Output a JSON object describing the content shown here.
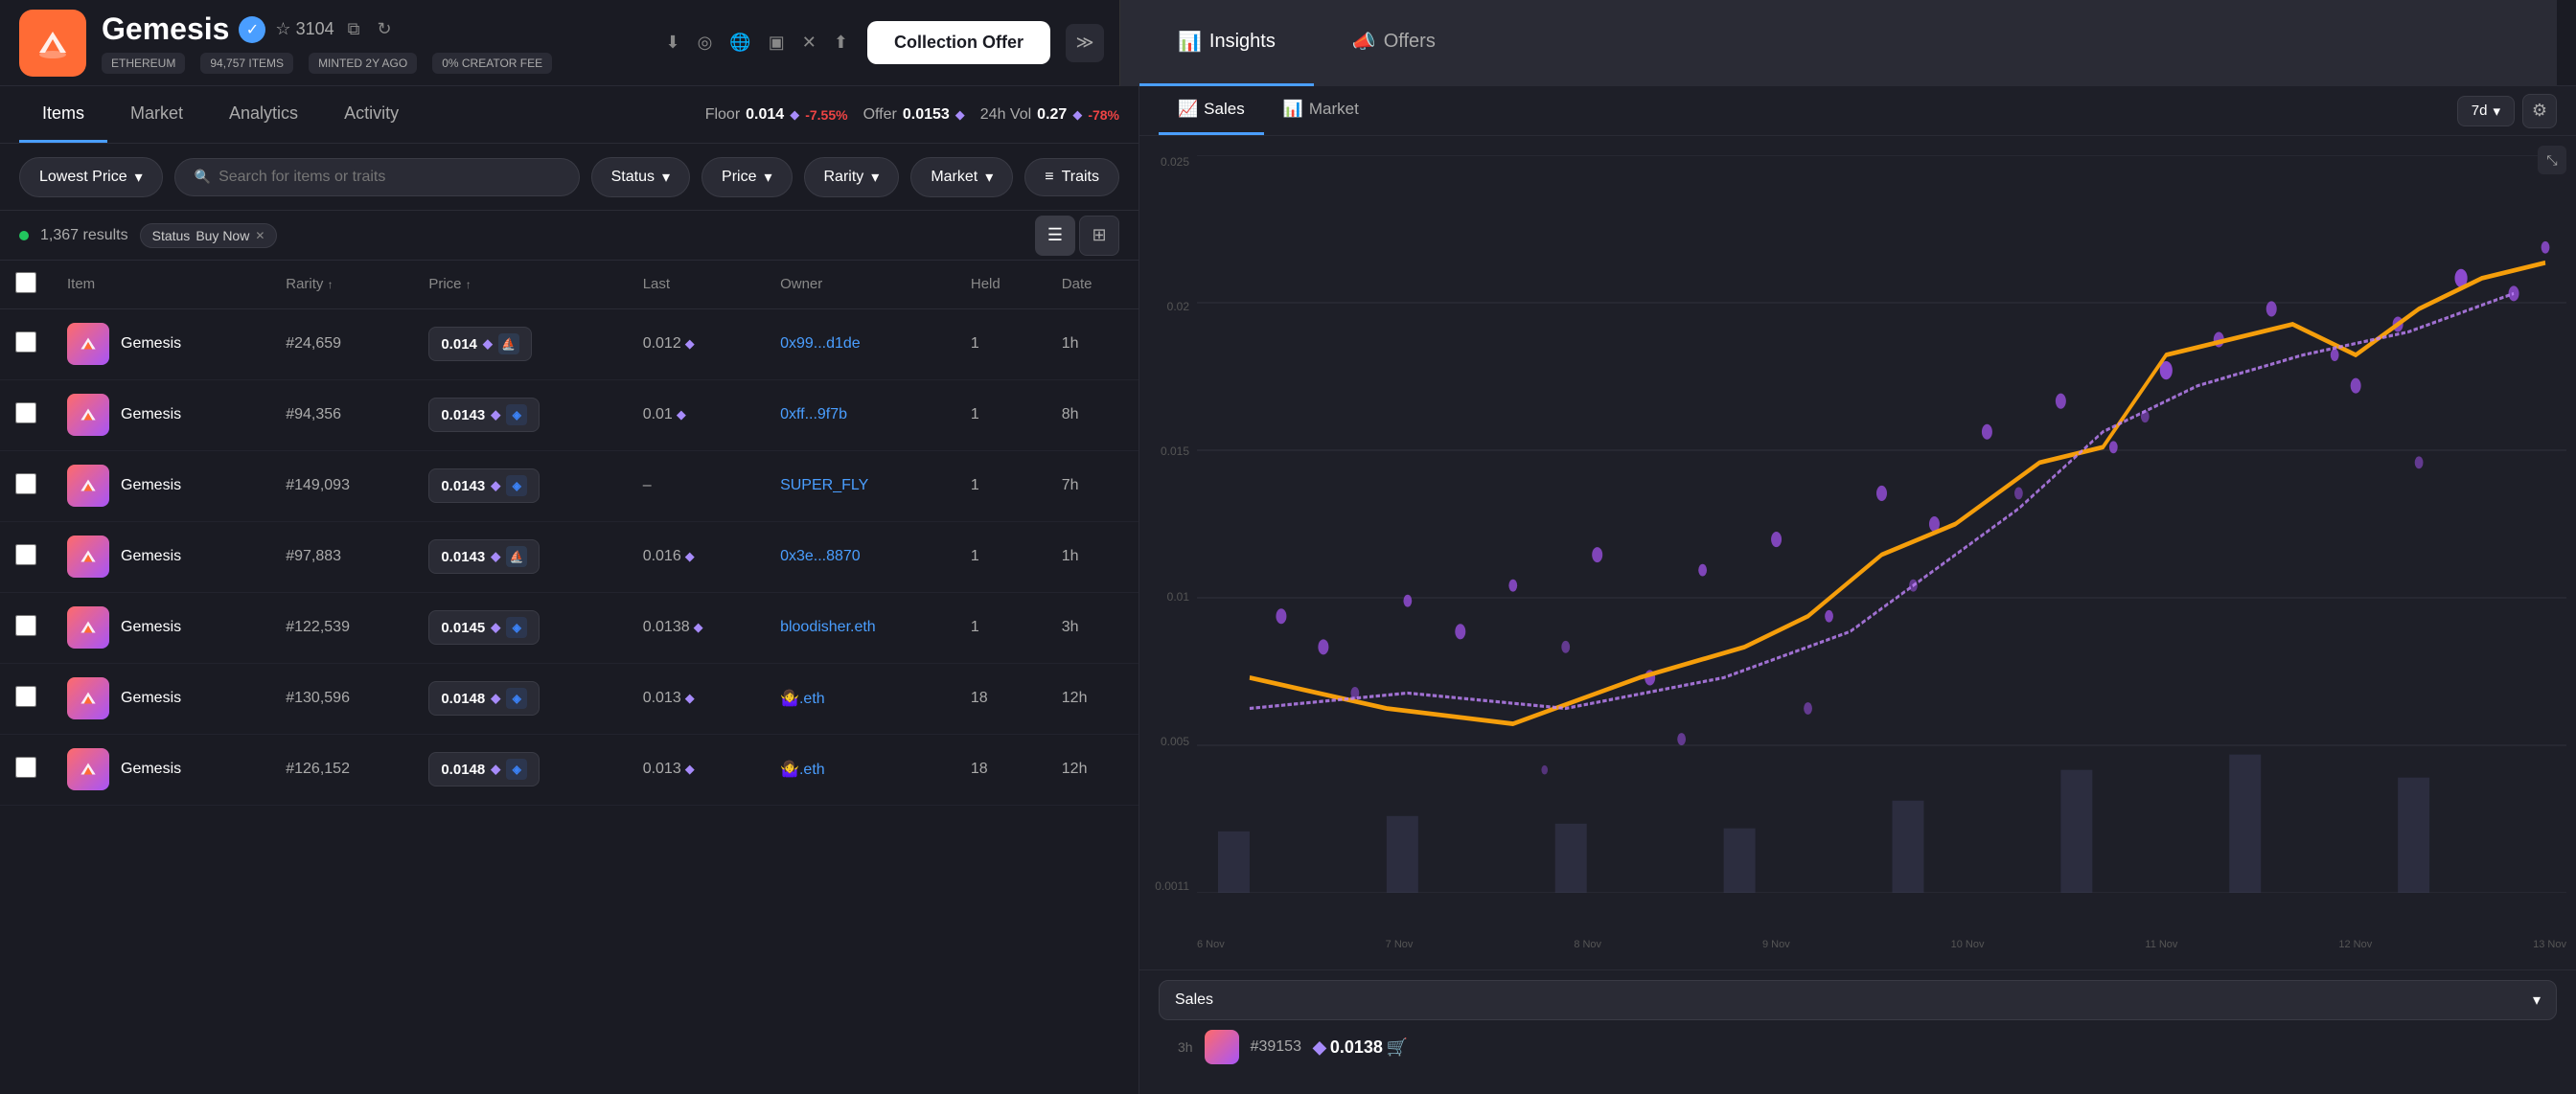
{
  "header": {
    "logo_emoji": "⛵",
    "collection_name": "Gemesis",
    "verified": true,
    "star_count": "3104",
    "chain": "ETHEREUM",
    "items_count": "94,757 ITEMS",
    "minted": "MINTED 2Y AGO",
    "creator_fee": "0% CREATOR FEE",
    "collection_offer_label": "Collection Offer"
  },
  "insights_panel": {
    "insights_label": "Insights",
    "offers_label": "Offers"
  },
  "nav": {
    "tabs": [
      "Items",
      "Market",
      "Analytics",
      "Activity"
    ],
    "active": "Items"
  },
  "price_bar": {
    "floor_label": "Floor",
    "floor_value": "0.014",
    "floor_change": "-7.55%",
    "offer_label": "Offer",
    "offer_value": "0.0153",
    "vol_label": "24h Vol",
    "vol_value": "0.27",
    "vol_change": "-78%"
  },
  "filters": {
    "sort_label": "Lowest Price",
    "search_placeholder": "Search for items or traits",
    "status_label": "Status",
    "price_label": "Price",
    "rarity_label": "Rarity",
    "market_label": "Market",
    "traits_label": "Traits"
  },
  "results": {
    "count": "1,367 results",
    "status_badge_label": "Status",
    "status_badge_value": "Buy Now"
  },
  "table": {
    "columns": [
      "Item",
      "Rarity ↑",
      "Price ↑",
      "Last",
      "Owner",
      "Held",
      "Date"
    ],
    "rows": [
      {
        "id": 1,
        "name": "Gemesis",
        "rarity": "#24,659",
        "price": "0.014",
        "price_market": "os",
        "last": "0.012",
        "owner": "0x99...d1de",
        "owner_type": "address",
        "held": "1",
        "date": "1h"
      },
      {
        "id": 2,
        "name": "Gemesis",
        "rarity": "#94,356",
        "price": "0.0143",
        "price_market": "blue",
        "last": "0.01",
        "owner": "0xff...9f7b",
        "owner_type": "address",
        "held": "1",
        "date": "8h"
      },
      {
        "id": 3,
        "name": "Gemesis",
        "rarity": "#149,093",
        "price": "0.0143",
        "price_market": "blue",
        "last": "–",
        "owner": "SUPER_FLY",
        "owner_type": "named",
        "held": "1",
        "date": "7h"
      },
      {
        "id": 4,
        "name": "Gemesis",
        "rarity": "#97,883",
        "price": "0.0143",
        "price_market": "os",
        "last": "0.016",
        "owner": "0x3e...8870",
        "owner_type": "address",
        "held": "1",
        "date": "1h"
      },
      {
        "id": 5,
        "name": "Gemesis",
        "rarity": "#122,539",
        "price": "0.0145",
        "price_market": "blue",
        "last": "0.0138",
        "owner": "bloodisher.eth",
        "owner_type": "named",
        "held": "1",
        "date": "3h"
      },
      {
        "id": 6,
        "name": "Gemesis",
        "rarity": "#130,596",
        "price": "0.0148",
        "price_market": "blue",
        "last": "0.013",
        "owner": "🤷‍♀️.eth",
        "owner_type": "named",
        "held": "18",
        "date": "12h"
      },
      {
        "id": 7,
        "name": "Gemesis",
        "rarity": "#126,152",
        "price": "0.0148",
        "price_market": "blue",
        "last": "0.013",
        "owner": "🤷‍♀️.eth",
        "owner_type": "named",
        "held": "18",
        "date": "12h"
      }
    ]
  },
  "right_panel": {
    "sales_tab": "Sales",
    "market_tab": "Market",
    "time_period": "7d",
    "y_labels": [
      "0.025",
      "0.02",
      "0.015",
      "0.01",
      "0.005",
      "0.0011"
    ],
    "x_labels": [
      "6 Nov",
      "7 Nov",
      "8 Nov",
      "9 Nov",
      "10 Nov",
      "11 Nov",
      "12 Nov",
      "13 Nov"
    ],
    "sales_dropdown_label": "Sales",
    "bottom_id": "#39153",
    "bottom_price": "0.0138",
    "bottom_time": "3h"
  }
}
